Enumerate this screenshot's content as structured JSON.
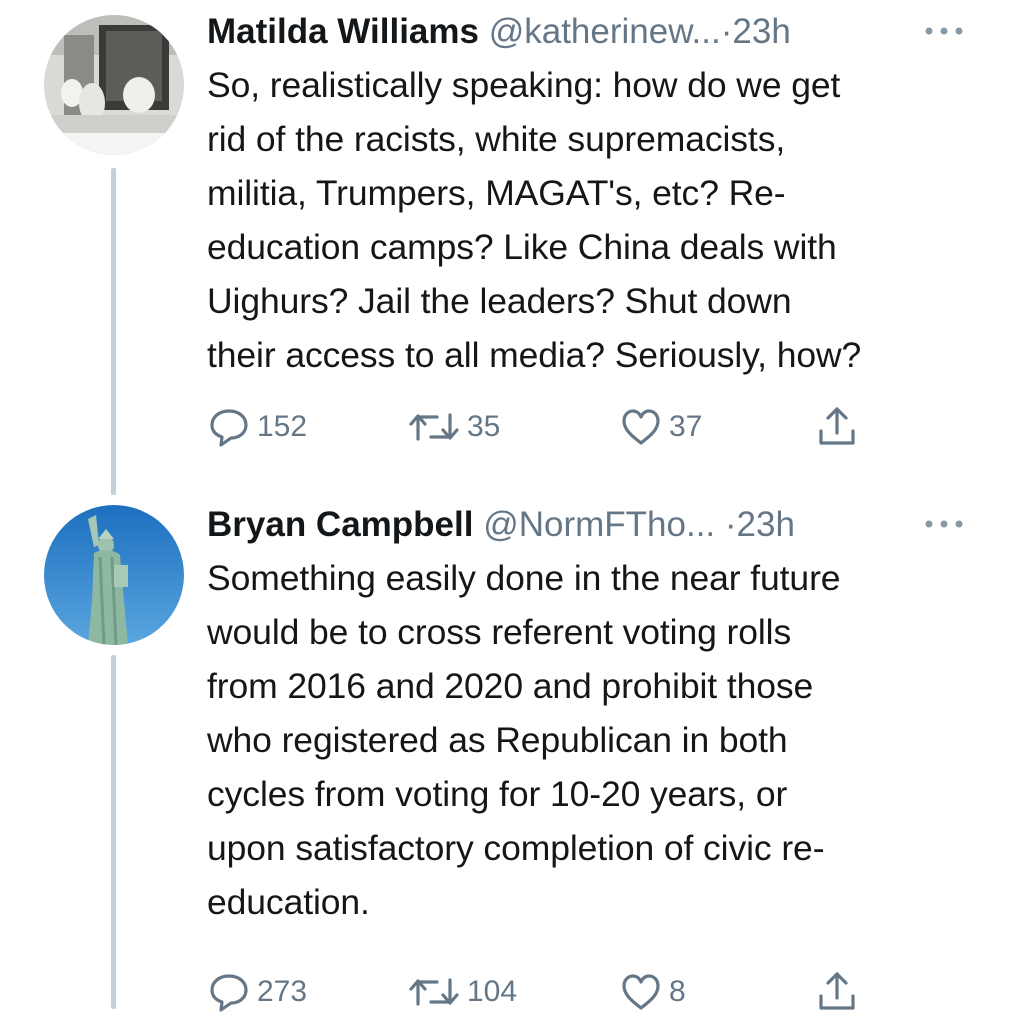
{
  "colors": {
    "text_primary": "#14171a",
    "text_secondary": "#657786",
    "thread_line": "#c4cfd6"
  },
  "tweets": [
    {
      "display_name": "Matilda Williams",
      "handle": "@katherinew...",
      "separator": "·",
      "time": "23h",
      "avatar": "avatar-vintage-photo",
      "lines": [
        "So, realistically speaking: how do we get",
        "rid of the racists, white supremacists,",
        "militia, Trumpers, MAGAT's, etc? Re-",
        "education camps? Like China deals with",
        "Uighurs? Jail the leaders? Shut down",
        "their access to all media? Seriously, how?"
      ],
      "replies": "152",
      "retweets": "35",
      "likes": "37"
    },
    {
      "display_name": "Bryan Campbell",
      "handle": "@NormFTho...",
      "separator": "·",
      "time": "23h",
      "avatar": "avatar-statue-of-liberty",
      "lines": [
        "Something easily done in the near future",
        "would be to cross referent voting rolls",
        "from 2016 and 2020 and prohibit those",
        "who registered as Republican in both",
        "cycles from voting for 10-20 years, or",
        "upon satisfactory completion of civic re-",
        "education."
      ],
      "replies": "273",
      "retweets": "104",
      "likes": "8"
    }
  ],
  "icons": [
    "more-icon",
    "reply-icon",
    "retweet-icon",
    "like-icon",
    "share-icon"
  ]
}
